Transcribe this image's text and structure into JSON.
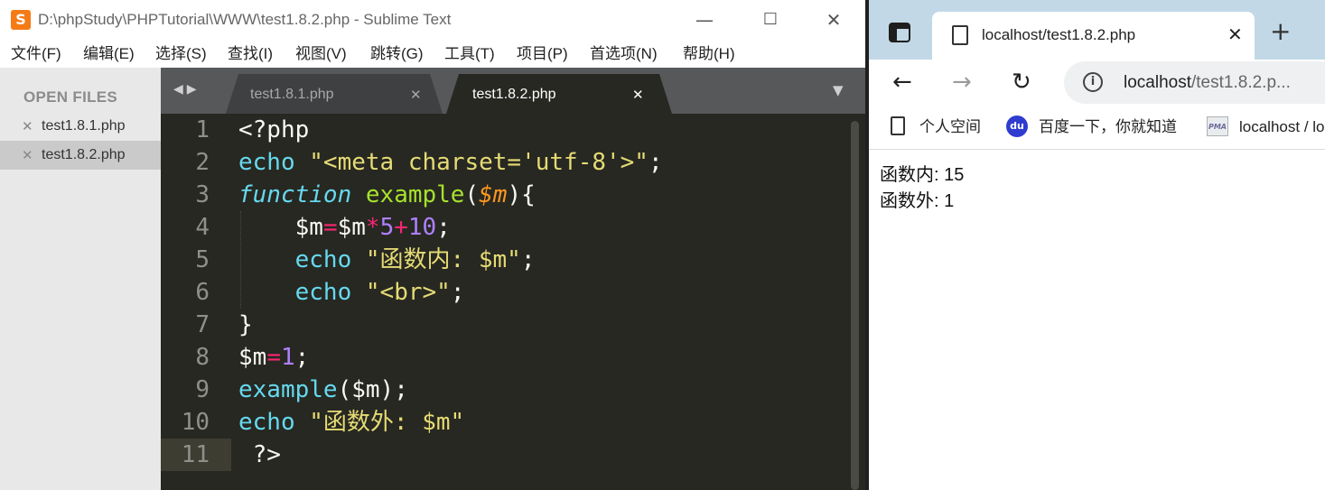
{
  "sublime": {
    "title": "D:\\phpStudy\\PHPTutorial\\WWW\\test1.8.2.php - Sublime Text",
    "logo_glyph": "S",
    "min_glyph": "—",
    "max_glyph": "☐",
    "close_glyph": "✕",
    "menu": [
      "文件(F)",
      "编辑(E)",
      "选择(S)",
      "查找(I)",
      "视图(V)",
      "跳转(G)",
      "工具(T)",
      "项目(P)",
      "首选项(N)",
      "帮助(H)"
    ],
    "sidebar": {
      "heading": "OPEN FILES",
      "files": [
        {
          "close": "✕",
          "name": "test1.8.1.php"
        },
        {
          "close": "✕",
          "name": "test1.8.2.php"
        }
      ]
    },
    "tab_nav": "◀▶",
    "tabs": [
      {
        "label": "test1.8.1.php",
        "close": "✕"
      },
      {
        "label": "test1.8.2.php",
        "close": "✕"
      }
    ],
    "tab_dropdown": "▼",
    "line_numbers": [
      "1",
      "2",
      "3",
      "4",
      "5",
      "6",
      "7",
      "8",
      "9",
      "10",
      "11"
    ],
    "code": {
      "l1": "<?php",
      "l2_kw": "echo",
      "l2_str": "\"<meta charset='utf-8'>\"",
      "l2_end": ";",
      "l3_kw": "function",
      "l3_name": "example",
      "l3_open": "(",
      "l3_param": "$m",
      "l3_close": "){",
      "l4_var": "$m",
      "l4_eq": "=",
      "l4_var2": "$m",
      "l4_mul": "*",
      "l4_five": "5",
      "l4_plus": "+",
      "l4_ten": "10",
      "l4_end": ";",
      "l5_kw": "echo",
      "l5_str": "\"函数内: $m\"",
      "l5_end": ";",
      "l6_kw": "echo",
      "l6_str": "\"<br>\"",
      "l6_end": ";",
      "l7": "}",
      "l8_var": "$m",
      "l8_eq": "=",
      "l8_num": "1",
      "l8_end": ";",
      "l9_call": "example",
      "l9_args": "($m);",
      "l10_kw": "echo",
      "l10_str": "\"函数外: $m\"",
      "l11": " ?>"
    }
  },
  "browser": {
    "tab_title": "localhost/test1.8.2.php",
    "tab_close": "✕",
    "new_tab": "+",
    "back": "←",
    "forward": "→",
    "reload": "↻",
    "info_glyph": "i",
    "url_host": "localhost",
    "url_path": "/test1.8.2.p...",
    "bookmarks": [
      {
        "label": "个人空间"
      },
      {
        "label": "百度一下，你就知道",
        "icon_text": "du"
      },
      {
        "label": "localhost / lo",
        "icon_text": "PMA"
      }
    ],
    "output": [
      "函数内: 15",
      "函数外: 1"
    ]
  }
}
